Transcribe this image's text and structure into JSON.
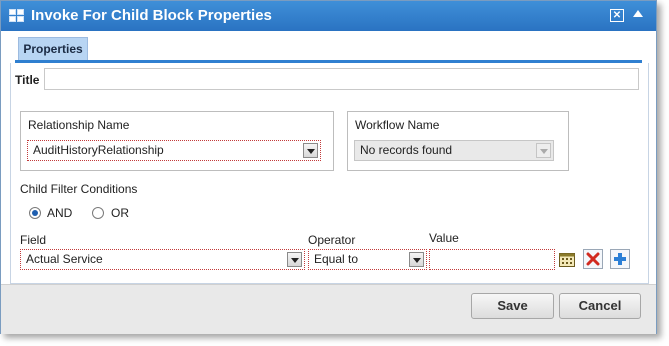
{
  "dialog": {
    "title": "Invoke For Child Block Properties"
  },
  "tabs": [
    {
      "label": "Properties"
    }
  ],
  "form": {
    "title_label": "Title",
    "title_value": "",
    "relationship": {
      "label": "Relationship Name",
      "value": "AuditHistoryRelationship"
    },
    "workflow": {
      "label": "Workflow Name",
      "value": "No records found"
    },
    "filter": {
      "label": "Child Filter Conditions",
      "and_label": "AND",
      "or_label": "OR",
      "selected": "AND"
    },
    "condition": {
      "field_label": "Field",
      "field_value": "Actual Service",
      "operator_label": "Operator",
      "operator_value": "Equal to",
      "value_label": "Value",
      "value_value": ""
    }
  },
  "footer": {
    "save_label": "Save",
    "cancel_label": "Cancel"
  },
  "colors": {
    "titlebar": "#2a73c2",
    "tab_active": "#b8d5f3",
    "required_border": "#c23a3a"
  }
}
